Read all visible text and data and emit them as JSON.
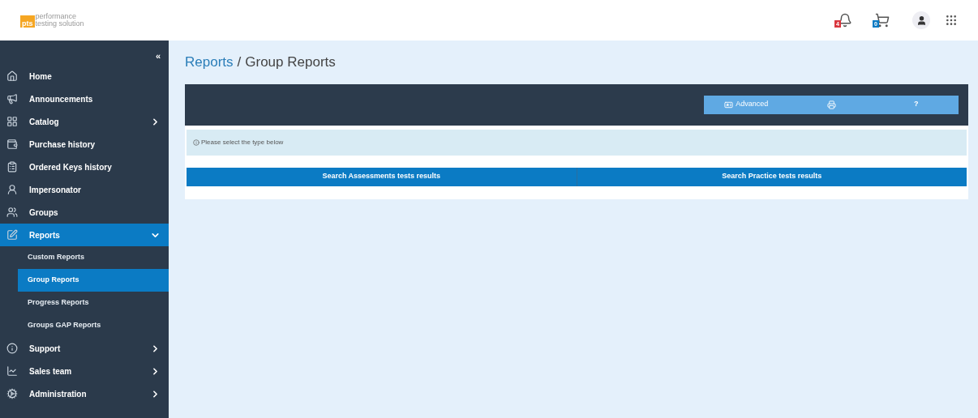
{
  "logo": {
    "mark": "pts",
    "line1": "performance",
    "line2": "testing solution"
  },
  "header": {
    "notifications_badge": "4",
    "cart_badge": "0"
  },
  "sidebar": {
    "collapse": "«",
    "items": [
      {
        "label": "Home",
        "kind": "link",
        "selected": false
      },
      {
        "label": "Announcements",
        "kind": "link",
        "selected": false
      },
      {
        "label": "Catalog",
        "kind": "group",
        "expanded": false,
        "selected": false
      },
      {
        "label": "Purchase history",
        "kind": "link",
        "selected": false
      },
      {
        "label": "Ordered Keys history",
        "kind": "link",
        "selected": false
      },
      {
        "label": "Impersonator",
        "kind": "link",
        "selected": false
      },
      {
        "label": "Groups",
        "kind": "link",
        "selected": false
      },
      {
        "label": "Reports",
        "kind": "group",
        "expanded": true,
        "selected": true,
        "children": [
          {
            "label": "Custom Reports",
            "selected": false
          },
          {
            "label": "Group Reports",
            "selected": true
          },
          {
            "label": "Progress Reports",
            "selected": false
          },
          {
            "label": "Groups GAP Reports",
            "selected": false
          }
        ]
      },
      {
        "label": "Support",
        "kind": "group",
        "expanded": false,
        "selected": false
      },
      {
        "label": "Sales team",
        "kind": "group",
        "expanded": false,
        "selected": false
      },
      {
        "label": "Administration",
        "kind": "group",
        "expanded": false,
        "selected": false
      }
    ]
  },
  "breadcrumb": {
    "parent": "Reports",
    "separator": "/",
    "current": "Group Reports"
  },
  "toolbar": {
    "advanced": "Advanced",
    "help": "?"
  },
  "alert": "Please select the type below",
  "search_buttons": [
    "Search Assessments tests results",
    "Search Practice tests results"
  ]
}
